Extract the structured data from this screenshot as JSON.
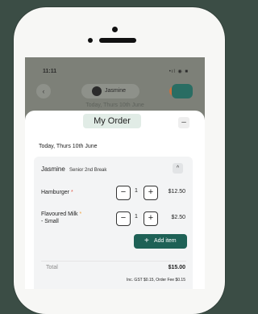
{
  "status_bar": {
    "time": "11:11",
    "icons": "•ıl ◉ ■"
  },
  "top_bar": {
    "child_name": "Jasmine",
    "background_date": "Today, Thurs 10th June"
  },
  "sheet": {
    "title": "My Order",
    "close_label": "–",
    "date": "Today, Thurs 10th June",
    "child": {
      "name": "Jasmine",
      "subtitle": "Senior 2nd Break",
      "collapse_label": "^"
    },
    "items": [
      {
        "name": "Hamburger",
        "required_mark": "*",
        "qty": "1",
        "price": "$12.50"
      },
      {
        "name_line1": "Flavoured Milk",
        "name_line2": "- Small",
        "required_mark": "*",
        "qty": "1",
        "price": "$2.50"
      }
    ],
    "stepper": {
      "minus": "−",
      "plus": "+"
    },
    "add_item_label": "Add item",
    "add_item_plus": "+",
    "total_label": "Total",
    "total_value": "$15.00",
    "fees_text": "Inc. GST $0.15, Order Fee $0.15"
  },
  "colors": {
    "accent": "#1e6156",
    "title_pill": "#e1ece6",
    "required_red": "#e25a4a",
    "required_orange": "#f0a33c"
  }
}
